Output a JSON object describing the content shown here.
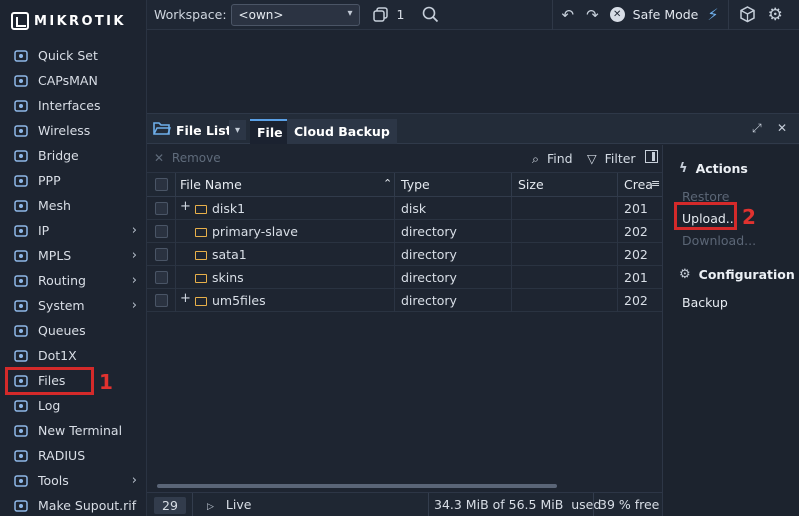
{
  "brand": "MIKROTIK",
  "sidebar": {
    "items": [
      {
        "label": "Quick Set",
        "icon": "magic-wand-icon",
        "has_submenu": false
      },
      {
        "label": "CAPsMAN",
        "icon": "capsman-icon",
        "has_submenu": false
      },
      {
        "label": "Interfaces",
        "icon": "interfaces-icon",
        "has_submenu": false
      },
      {
        "label": "Wireless",
        "icon": "wireless-icon",
        "has_submenu": false
      },
      {
        "label": "Bridge",
        "icon": "bridge-icon",
        "has_submenu": false
      },
      {
        "label": "PPP",
        "icon": "ppp-icon",
        "has_submenu": false
      },
      {
        "label": "Mesh",
        "icon": "mesh-icon",
        "has_submenu": false
      },
      {
        "label": "IP",
        "icon": "ip-icon",
        "has_submenu": true
      },
      {
        "label": "MPLS",
        "icon": "mpls-icon",
        "has_submenu": true
      },
      {
        "label": "Routing",
        "icon": "routing-icon",
        "has_submenu": true
      },
      {
        "label": "System",
        "icon": "gear-icon",
        "has_submenu": true
      },
      {
        "label": "Queues",
        "icon": "queues-icon",
        "has_submenu": false
      },
      {
        "label": "Dot1X",
        "icon": "dot1x-icon",
        "has_submenu": false
      },
      {
        "label": "Files",
        "icon": "folder-icon",
        "has_submenu": false
      },
      {
        "label": "Log",
        "icon": "log-icon",
        "has_submenu": false
      },
      {
        "label": "New Terminal",
        "icon": "terminal-icon",
        "has_submenu": false
      },
      {
        "label": "RADIUS",
        "icon": "radius-icon",
        "has_submenu": false
      },
      {
        "label": "Tools",
        "icon": "tools-icon",
        "has_submenu": true
      },
      {
        "label": "Make Supout.rif",
        "icon": "supout-icon",
        "has_submenu": false
      }
    ],
    "chevron": "›"
  },
  "topbar": {
    "workspace_label": "Workspace:",
    "workspace_value": "<own>",
    "windows_count": "1",
    "safe_mode_label": "Safe Mode"
  },
  "window": {
    "title": "File List",
    "tabs": [
      "File",
      "Cloud Backup"
    ],
    "active_tab": "File",
    "toolbar": {
      "remove_label": "Remove",
      "find_label": "Find",
      "filter_label": "Filter"
    },
    "columns": [
      "File Name",
      "Type",
      "Size",
      "Crea"
    ],
    "rows": [
      {
        "name": "disk1",
        "type": "disk",
        "size": "",
        "created": "201",
        "expandable": true
      },
      {
        "name": "primary-slave",
        "type": "directory",
        "size": "",
        "created": "202",
        "expandable": false
      },
      {
        "name": "sata1",
        "type": "directory",
        "size": "",
        "created": "202",
        "expandable": false
      },
      {
        "name": "skins",
        "type": "directory",
        "size": "",
        "created": "201",
        "expandable": false
      },
      {
        "name": "um5files",
        "type": "directory",
        "size": "",
        "created": "202",
        "expandable": true
      }
    ],
    "status": {
      "count": "29",
      "live_label": "Live",
      "used": "34.3 MiB of 56.5 MiB  used",
      "free": "39 % free"
    }
  },
  "actions_panel": {
    "actions_title": "Actions",
    "restore_label": "Restore",
    "upload_label": "Upload...",
    "download_label": "Download...",
    "configuration_title": "Configuration",
    "backup_label": "Backup"
  },
  "annotations": {
    "files_marker": "1",
    "upload_marker": "2",
    "highlight_color": "#d42a2a"
  },
  "colors": {
    "background": "#1d2430",
    "accent": "#5aa0e6",
    "folder": "#e8b04a"
  }
}
